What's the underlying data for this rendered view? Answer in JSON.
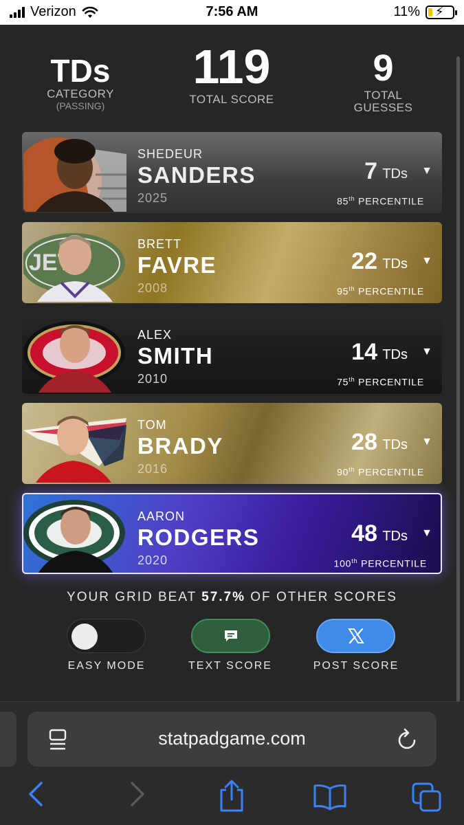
{
  "status_bar": {
    "carrier": "Verizon",
    "time": "7:56 AM",
    "battery": "11%"
  },
  "header": {
    "category_value": "TDs",
    "category_label": "CATEGORY",
    "category_sub": "(PASSING)",
    "total_score_value": "119",
    "total_score_label": "TOTAL SCORE",
    "guesses_value": "9",
    "guesses_label_1": "TOTAL",
    "guesses_label_2": "GUESSES"
  },
  "players": [
    {
      "first": "SHEDEUR",
      "last": "SANDERS",
      "year": "2025",
      "value": "7",
      "unit": "TDs",
      "pct_num": "85",
      "pct_suffix": "th",
      "pct_label": "PERCENTILE",
      "team_logo": "browns-helmet-logo"
    },
    {
      "first": "BRETT",
      "last": "FAVRE",
      "year": "2008",
      "value": "22",
      "unit": "TDs",
      "pct_num": "95",
      "pct_suffix": "th",
      "pct_label": "PERCENTILE",
      "team_logo": "jets-logo"
    },
    {
      "first": "ALEX",
      "last": "SMITH",
      "year": "2010",
      "value": "14",
      "unit": "TDs",
      "pct_num": "75",
      "pct_suffix": "th",
      "pct_label": "PERCENTILE",
      "team_logo": "49ers-logo"
    },
    {
      "first": "TOM",
      "last": "BRADY",
      "year": "2016",
      "value": "28",
      "unit": "TDs",
      "pct_num": "90",
      "pct_suffix": "th",
      "pct_label": "PERCENTILE",
      "team_logo": "patriots-logo"
    },
    {
      "first": "AARON",
      "last": "RODGERS",
      "year": "2020",
      "value": "48",
      "unit": "TDs",
      "pct_num": "100",
      "pct_suffix": "th",
      "pct_label": "PERCENTILE",
      "team_logo": "packers-logo"
    }
  ],
  "summary": {
    "prefix": "YOUR GRID BEAT",
    "percent": "57.7%",
    "suffix": "OF OTHER SCORES"
  },
  "actions": {
    "easy_mode_label": "EASY MODE",
    "easy_mode_on": false,
    "text_score_label": "TEXT SCORE",
    "post_score_label": "POST SCORE"
  },
  "browser": {
    "url": "statpadgame.com"
  },
  "colors": {
    "text_score_bg": "#2e5e3c",
    "post_score_bg": "#3f8be9",
    "ios_blue": "#3b82f6"
  }
}
